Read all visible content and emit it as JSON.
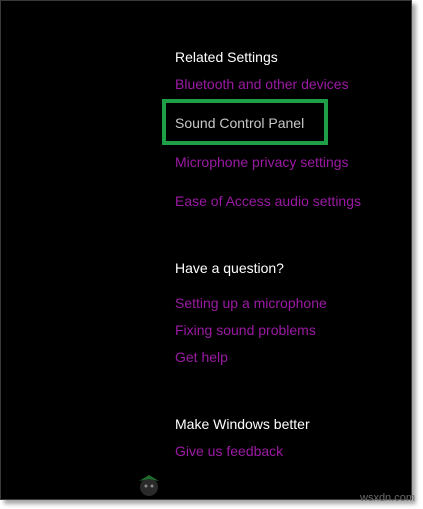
{
  "related": {
    "heading": "Related Settings",
    "links": [
      "Bluetooth and other devices",
      "Sound Control Panel",
      "Microphone privacy settings",
      "Ease of Access audio settings"
    ]
  },
  "question": {
    "heading": "Have a question?",
    "links": [
      "Setting up a microphone",
      "Fixing sound problems",
      "Get help"
    ]
  },
  "better": {
    "heading": "Make Windows better",
    "links": [
      "Give us feedback"
    ]
  },
  "watermark": {
    "text": "wsxdn.com"
  },
  "colors": {
    "background": "#000000",
    "link": "#9b1aa3",
    "heading": "#ffffff",
    "highlight_border": "#1f9e48"
  }
}
